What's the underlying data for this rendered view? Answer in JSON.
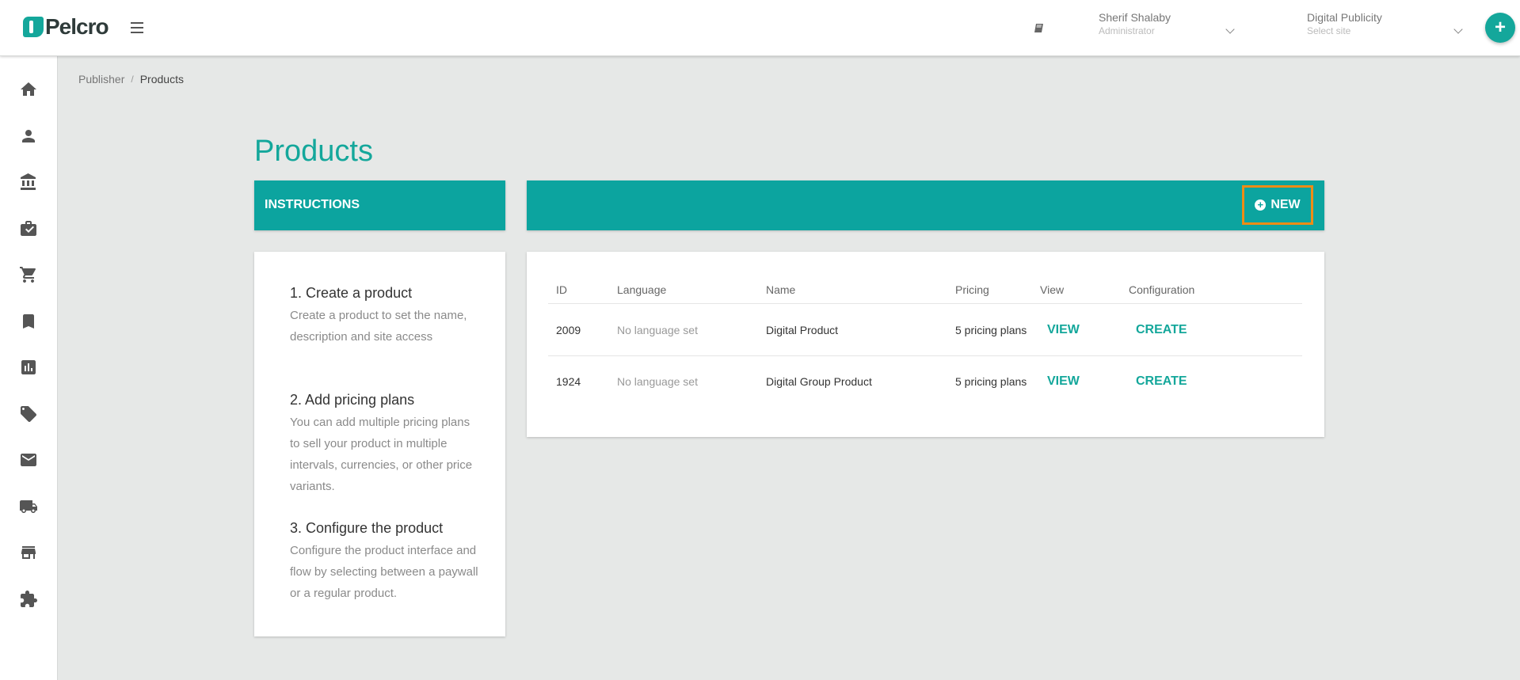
{
  "header": {
    "logo_text": "Pelcro",
    "user_name": "Sherif Shalaby",
    "user_role": "Administrator",
    "site_name": "Digital Publicity",
    "site_placeholder": "Select site",
    "fab_label": "+"
  },
  "sidebar": {
    "items": [
      "home-icon",
      "person-icon",
      "bank-icon",
      "briefcase-icon",
      "cart-icon",
      "bookmark-icon",
      "chart-icon",
      "ticket-icon",
      "mail-icon",
      "truck-icon",
      "store-icon",
      "puzzle-icon"
    ]
  },
  "breadcrumb": {
    "parent": "Publisher",
    "separator": "/",
    "current": "Products"
  },
  "page": {
    "title": "Products"
  },
  "instructions": {
    "header": "INSTRUCTIONS",
    "steps": [
      {
        "title": "1. Create a product",
        "body": "Create a product to set the name, description and site access"
      },
      {
        "title": "2. Add pricing plans",
        "body": "You can add multiple pricing plans to sell your product in multiple intervals, currencies, or other price variants."
      },
      {
        "title": "3. Configure the product",
        "body": "Configure the product interface and flow by selecting between a paywall or a regular product."
      }
    ]
  },
  "products": {
    "new_label": "NEW",
    "columns": [
      "ID",
      "Language",
      "Name",
      "Pricing",
      "View",
      "Configuration"
    ],
    "rows": [
      {
        "id": "2009",
        "language": "No language set",
        "name": "Digital Product",
        "pricing": "5 pricing plans",
        "view": "VIEW",
        "config": "CREATE"
      },
      {
        "id": "1924",
        "language": "No language set",
        "name": "Digital Group Product",
        "pricing": "5 pricing plans",
        "view": "VIEW",
        "config": "CREATE"
      }
    ]
  },
  "colors": {
    "accent": "#14a79b",
    "header_bar": "#0ca49f",
    "highlight": "#ee8c15"
  }
}
